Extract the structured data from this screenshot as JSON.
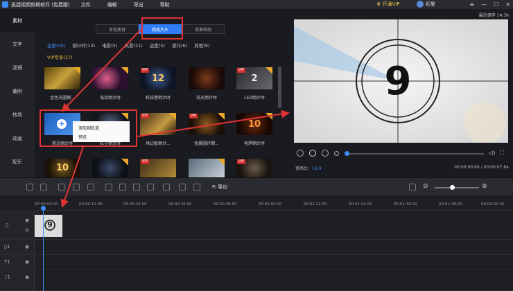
{
  "titlebar": {
    "app_title": "迅捷视频剪辑软件 (免费版)",
    "menus": [
      "文件",
      "编辑",
      "导出",
      "帮助"
    ],
    "vip_label": "开通VIP",
    "username": "初夏"
  },
  "sidebar": {
    "items": [
      "素材",
      "文字",
      "滤镜",
      "叠附",
      "转场",
      "动画",
      "配乐"
    ]
  },
  "library": {
    "tabs": [
      "本地素材",
      "精美片头",
      "背景样例"
    ],
    "active_tab": 1,
    "categories": [
      "全部(49)",
      "倒计时(13)",
      "电影(5)",
      "风景(11)",
      "运度(5)",
      "旅行(6)",
      "其他(9)"
    ],
    "vip_category": "VIP专享(17)",
    "row1": [
      "金色光圈倒...",
      "电流倒计时",
      "科技感倒计时",
      "流光倒计时",
      "LED倒计时"
    ],
    "row2": [
      "简洁倒计时",
      "粒子倒计时",
      "场记板倒计...",
      "金属圆环倒...",
      "电焊倒计时"
    ],
    "context_menu": [
      "添加到轨道",
      "预览"
    ]
  },
  "preview": {
    "save_time": "最近保存 14:30",
    "frame_number": "9",
    "aspect_label": "宽高比:",
    "aspect_value": "16:9",
    "timecode": "00:00:00.00 / 00:00:07.64",
    "progress_fraction": 0.0
  },
  "toolbar": {
    "export_label": "导出",
    "zoom_fraction": 0.35
  },
  "timeline": {
    "ruler": [
      "00:00:00.00",
      "00:00:12.00",
      "00:00:24.00",
      "00:00:36.00",
      "00:00:48.00",
      "00:01:00.00",
      "00:01:12.00",
      "00:01:24.00",
      "00:01:36.00",
      "00:01:48.00",
      "00:02:00.00"
    ],
    "clip_number": "9"
  },
  "colors": {
    "accent": "#2e7cf6",
    "highlight": "#e23333",
    "vip_gold": "#e9b53a"
  }
}
